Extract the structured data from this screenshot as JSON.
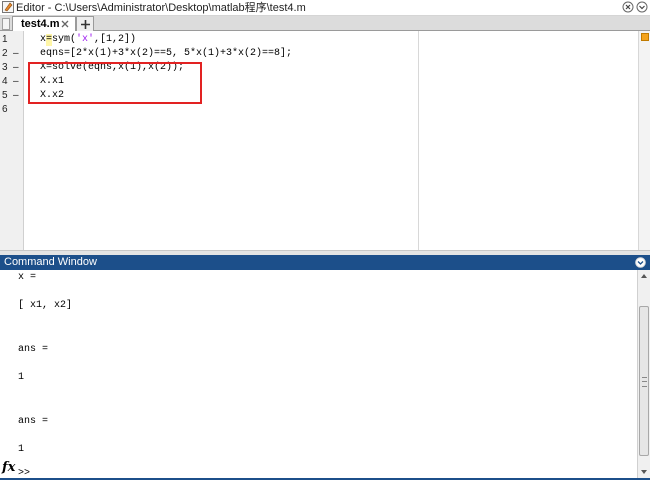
{
  "editor": {
    "title": "Editor - C:\\Users\\Administrator\\Desktop\\matlab程序\\test4.m",
    "tab_label": "test4.m",
    "add_tab_label": "+",
    "lines": [
      {
        "num": "1",
        "dash": "",
        "code_pre": "x=sym(",
        "code_str": "'x'",
        "code_post": ",[1,2])"
      },
      {
        "num": "2",
        "dash": "–",
        "code_pre": "eqns=[2*x(1)+3*x(2)==5, 5*x(1)+3*x(2)==8];",
        "code_str": "",
        "code_post": ""
      },
      {
        "num": "3",
        "dash": "–",
        "code_pre": "X=solve(eqns,x(1),x(2));",
        "code_str": "",
        "code_post": ""
      },
      {
        "num": "4",
        "dash": "–",
        "code_pre": "X.x1",
        "code_str": "",
        "code_post": ""
      },
      {
        "num": "5",
        "dash": "–",
        "code_pre": "X.x2",
        "code_str": "",
        "code_post": ""
      },
      {
        "num": "6",
        "dash": "",
        "code_pre": "",
        "code_str": "",
        "code_post": ""
      }
    ],
    "highlight_color": "#e22222"
  },
  "command_window": {
    "title": "Command Window",
    "output": [
      "x =",
      "[ x1, x2]",
      "ans =",
      "1",
      "ans =",
      "1"
    ],
    "prompt_symbol": "fx",
    "prompt_text": ">>"
  },
  "colors": {
    "header_blue": "#1c4f8a",
    "string_purple": "#a020f0",
    "annotation_red": "#e22222"
  }
}
